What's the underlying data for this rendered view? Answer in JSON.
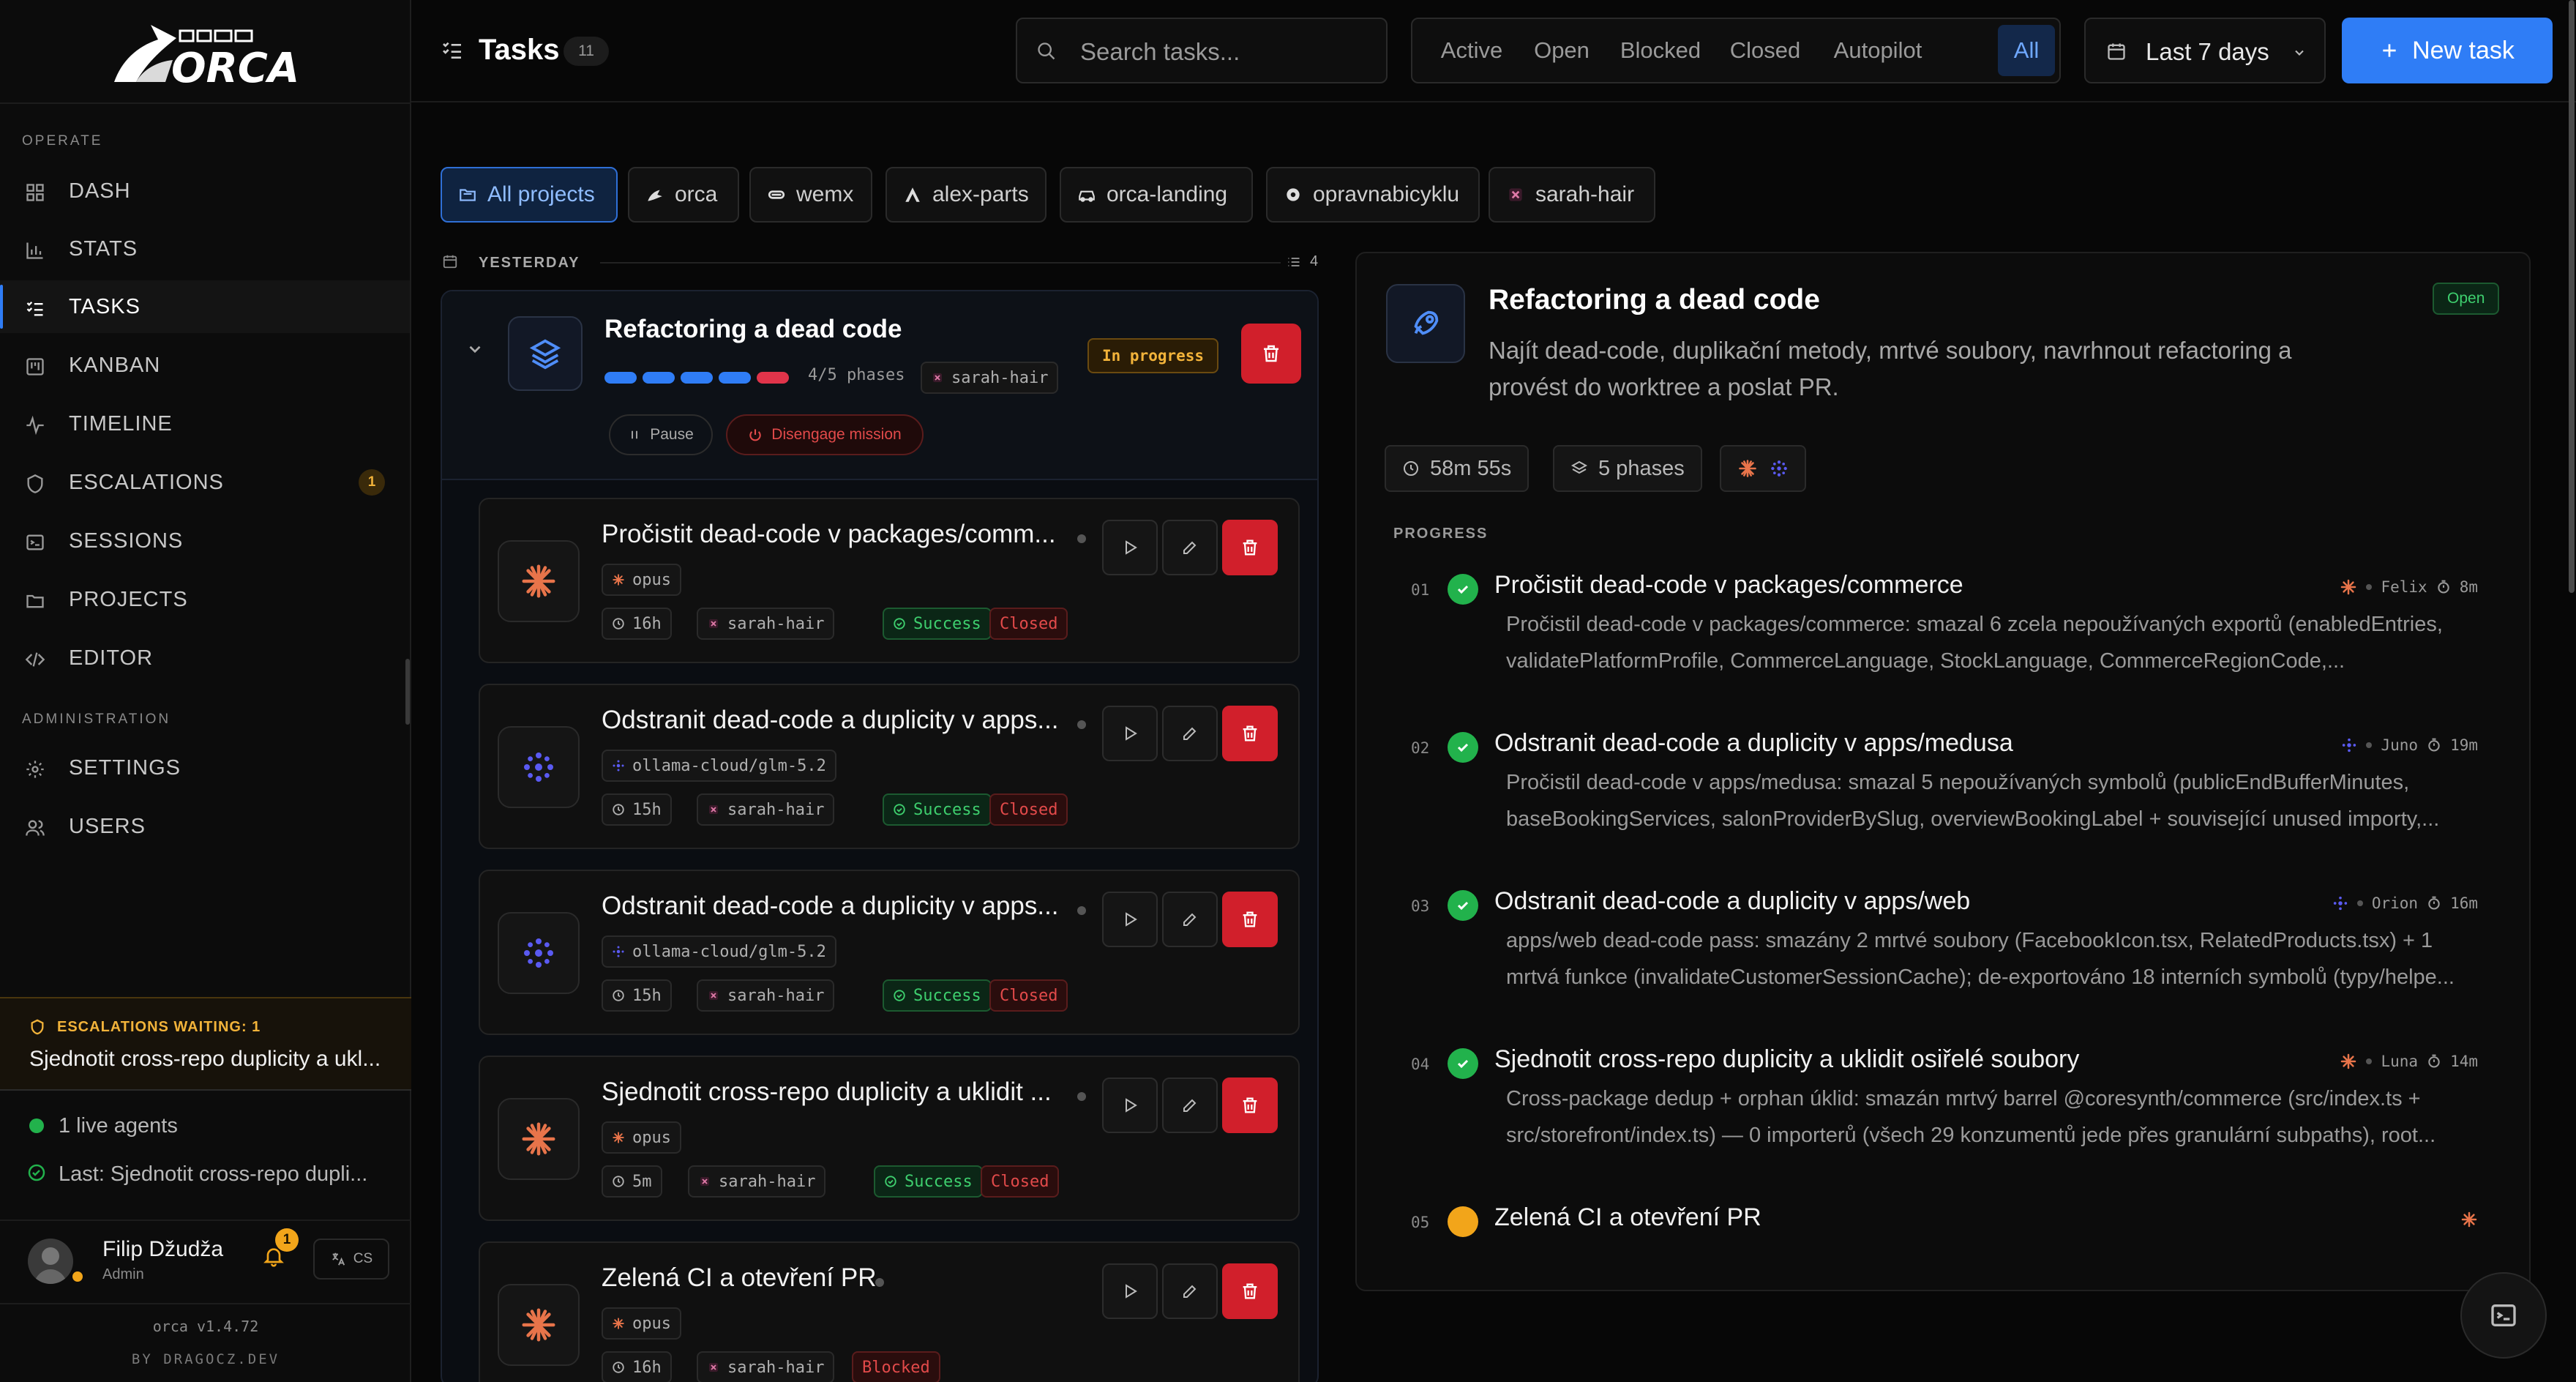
{
  "sidebar": {
    "logo_text": "ORCA",
    "section_operate": "OPERATE",
    "section_admin": "ADMINISTRATION",
    "nav": [
      {
        "label": "DASH",
        "icon": "grid-icon"
      },
      {
        "label": "STATS",
        "icon": "bar-chart-icon"
      },
      {
        "label": "TASKS",
        "icon": "checklist-icon"
      },
      {
        "label": "KANBAN",
        "icon": "kanban-icon"
      },
      {
        "label": "TIMELINE",
        "icon": "activity-icon"
      },
      {
        "label": "ESCALATIONS",
        "icon": "shield-icon",
        "badge": "1"
      },
      {
        "label": "SESSIONS",
        "icon": "terminal-icon"
      },
      {
        "label": "PROJECTS",
        "icon": "folder-icon"
      },
      {
        "label": "EDITOR",
        "icon": "code-icon"
      },
      {
        "label": "SETTINGS",
        "icon": "gear-icon"
      },
      {
        "label": "USERS",
        "icon": "users-icon"
      }
    ],
    "escalation": {
      "heading": "ESCALATIONS WAITING: 1",
      "text": "Sjednotit cross-repo duplicity a ukl..."
    },
    "agents": {
      "live": "1 live agents",
      "last": "Last: Sjednotit cross-repo dupli..."
    },
    "user": {
      "name": "Filip Džudža",
      "role": "Admin",
      "notif_count": "1",
      "lang": "CS"
    },
    "version": "orca v1.4.72",
    "credit": "BY DRAGOCZ.DEV"
  },
  "header": {
    "title": "Tasks",
    "count": "11",
    "search_placeholder": "Search tasks...",
    "filters": [
      "Active",
      "Open",
      "Blocked",
      "Closed",
      "Autopilot",
      "All"
    ],
    "active_filter": "All",
    "date_range": "Last 7 days",
    "new_task": "New task"
  },
  "projects": [
    "All projects",
    "orca",
    "wemx",
    "alex-parts",
    "orca-landing",
    "opravnabicyklu",
    "sarah-hair"
  ],
  "group": {
    "label": "YESTERDAY",
    "count": "4"
  },
  "mission": {
    "title": "Refactoring a dead code",
    "phases_text": "4/5 phases",
    "project": "sarah-hair",
    "status": "In progress",
    "pause": "Pause",
    "disengage": "Disengage mission",
    "progress_done": 4,
    "progress_total": 5
  },
  "tasks": [
    {
      "title": "Pročistit dead-code v packages/comm...",
      "model": "opus",
      "duration": "16h",
      "project": "sarah-hair",
      "result": "Success",
      "status": "Closed",
      "kind": "orange"
    },
    {
      "title": "Odstranit dead-code a duplicity v apps...",
      "model": "ollama-cloud/glm-5.2",
      "duration": "15h",
      "project": "sarah-hair",
      "result": "Success",
      "status": "Closed",
      "kind": "blue"
    },
    {
      "title": "Odstranit dead-code a duplicity v apps...",
      "model": "ollama-cloud/glm-5.2",
      "duration": "15h",
      "project": "sarah-hair",
      "result": "Success",
      "status": "Closed",
      "kind": "blue"
    },
    {
      "title": "Sjednotit cross-repo duplicity a uklidit ...",
      "model": "opus",
      "duration": "5m",
      "project": "sarah-hair",
      "result": "Success",
      "status": "Closed",
      "kind": "orange"
    },
    {
      "title": "Zelená CI a otevření PR",
      "model": "opus",
      "duration": "16h",
      "project": "sarah-hair",
      "result": "",
      "status": "Blocked",
      "kind": "orange"
    }
  ],
  "detail": {
    "title": "Refactoring a dead code",
    "status": "Open",
    "description_lines": [
      "Najít dead-code, duplikační metody, mrtvé soubory, navrhnout refactoring a",
      "provést do worktree a poslat PR."
    ],
    "duration": "58m 55s",
    "phases": "5 phases",
    "progress_label": "PROGRESS",
    "steps": [
      {
        "num": "01",
        "title": "Pročistit dead-code v packages/commerce",
        "agent": "Felix",
        "time": "8m",
        "done": true,
        "kind": "orange",
        "desc": [
          "Pročistil dead-code v packages/commerce: smazal 6 zcela nepoužívaných exportů (enabledEntries,",
          "validatePlatformProfile, CommerceLanguage, StockLanguage, CommerceRegionCode,..."
        ]
      },
      {
        "num": "02",
        "title": "Odstranit dead-code a duplicity v apps/medusa",
        "agent": "Juno",
        "time": "19m",
        "done": true,
        "kind": "blue",
        "desc": [
          "Pročistil dead-code v apps/medusa: smazal 5 nepoužívaných symbolů (publicEndBufferMinutes,",
          "baseBookingServices, salonProviderBySlug, overviewBookingLabel + související unused importy,..."
        ]
      },
      {
        "num": "03",
        "title": "Odstranit dead-code a duplicity v apps/web",
        "agent": "Orion",
        "time": "16m",
        "done": true,
        "kind": "blue",
        "desc": [
          "apps/web dead-code pass: smazány 2 mrtvé soubory (FacebookIcon.tsx, RelatedProducts.tsx) + 1",
          "mrtvá funkce (invalidateCustomerSessionCache); de-exportováno 18 interních symbolů (typy/helpe..."
        ]
      },
      {
        "num": "04",
        "title": "Sjednotit cross-repo duplicity a uklidit osiřelé soubory",
        "agent": "Luna",
        "time": "14m",
        "done": true,
        "kind": "orange",
        "desc": [
          "Cross-package dedup + orphan úklid: smazán mrtvý barrel @coresynth/commerce (src/index.ts +",
          "src/storefront/index.ts) — 0 importerů (všech 29 konzumentů jede přes granulární subpaths), root..."
        ]
      },
      {
        "num": "05",
        "title": "Zelená CI a otevření PR",
        "agent": "",
        "time": "",
        "done": false,
        "kind": "orange",
        "desc": []
      }
    ]
  },
  "colors": {
    "accent": "#2f7df6",
    "success": "#22b24c",
    "danger": "#d11f2b",
    "warning": "#f2a51a"
  }
}
